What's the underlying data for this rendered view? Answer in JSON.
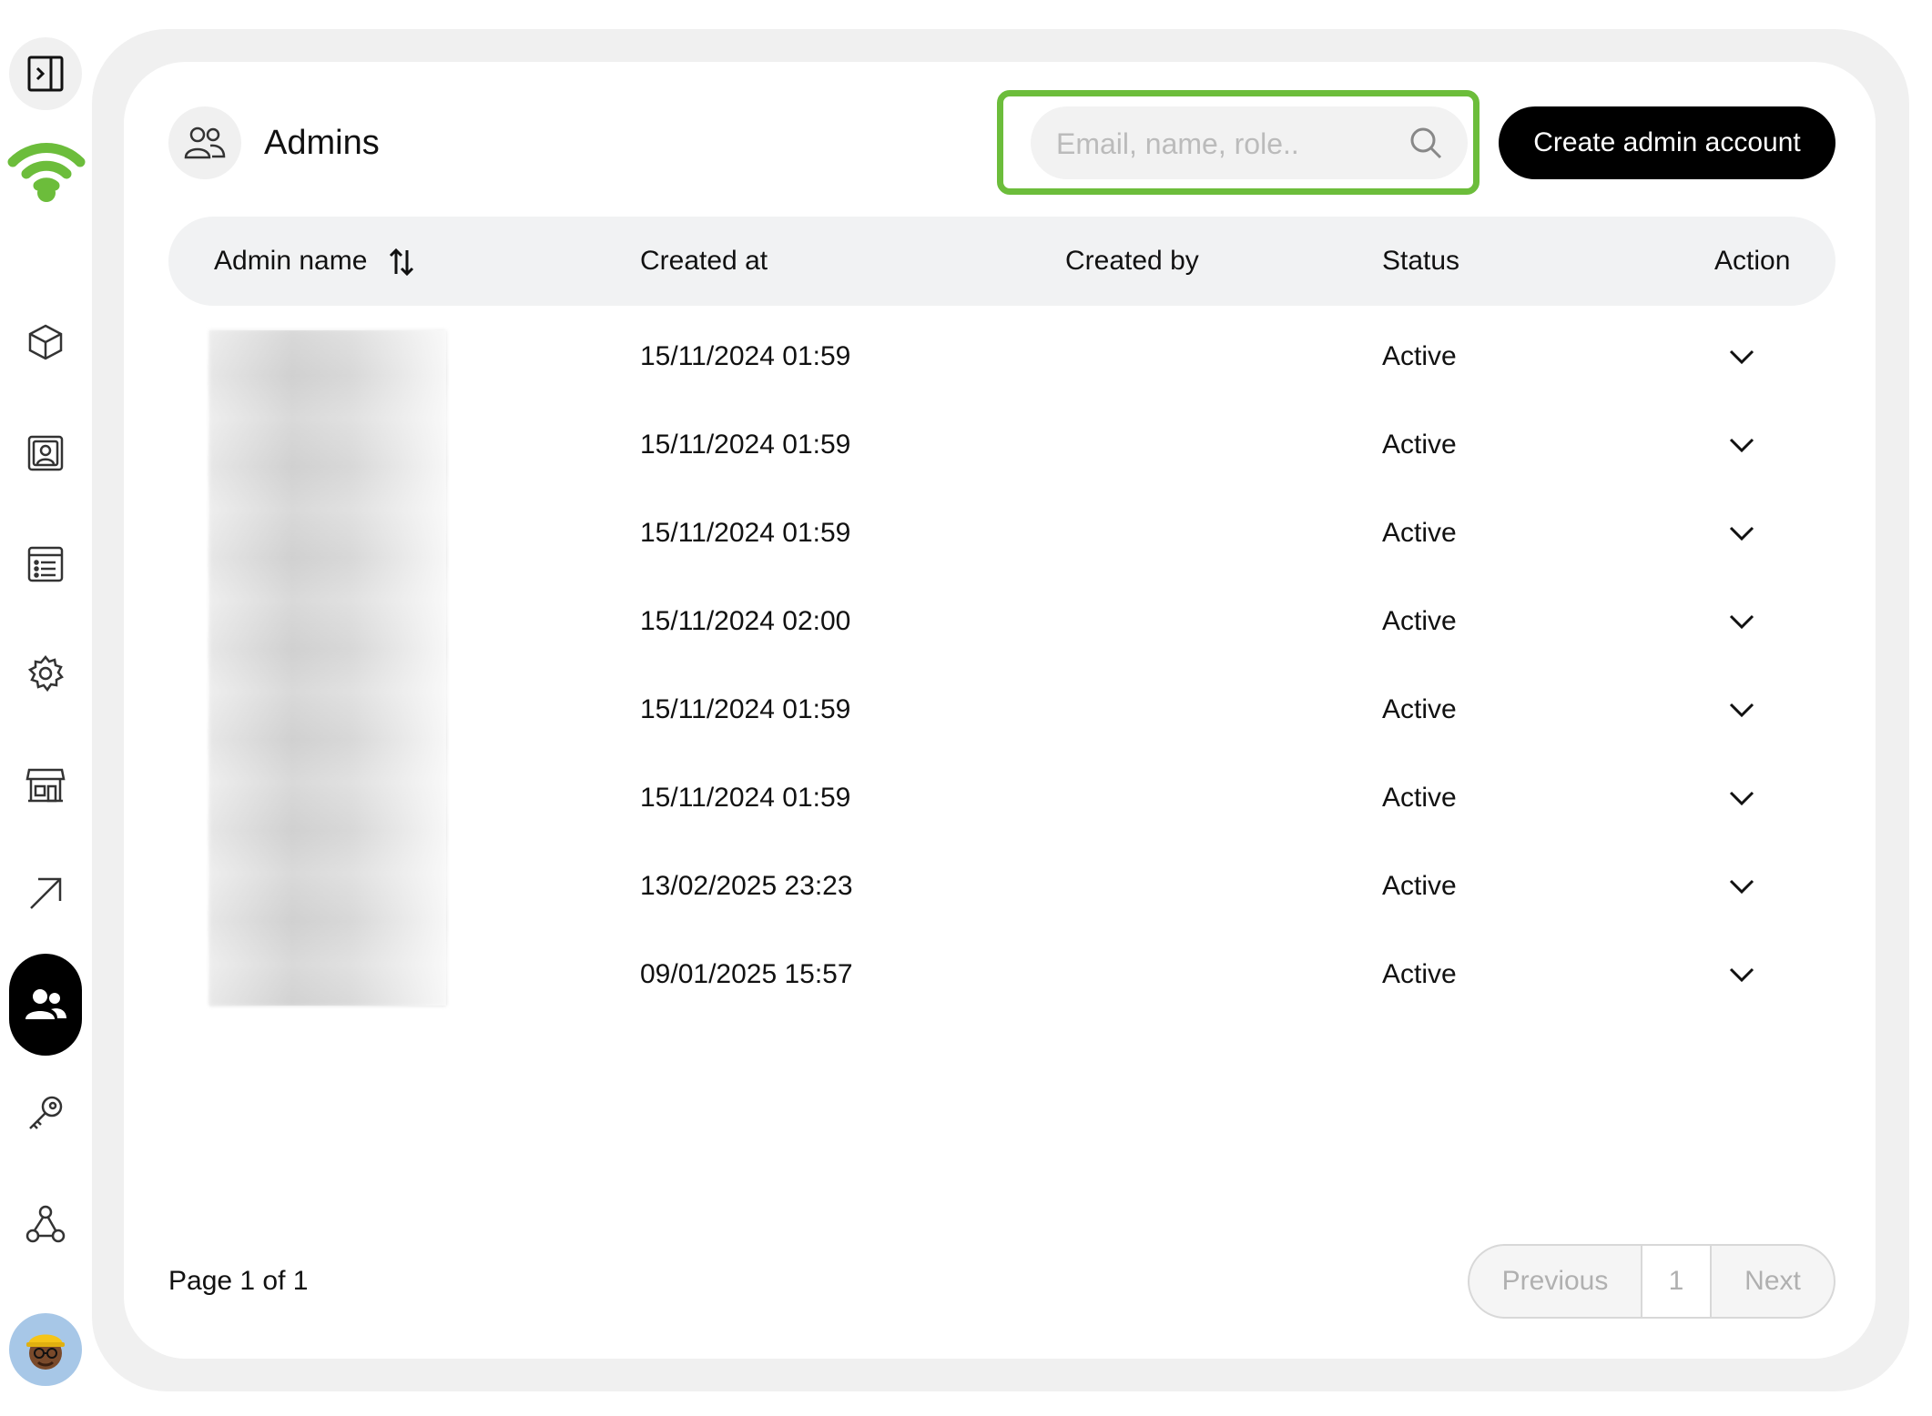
{
  "page": {
    "title": "Admins"
  },
  "sidebar": {
    "items": [
      {
        "name": "products",
        "icon": "box-icon"
      },
      {
        "name": "contacts",
        "icon": "contact-card-icon"
      },
      {
        "name": "lists",
        "icon": "list-icon"
      },
      {
        "name": "settings",
        "icon": "gear-icon"
      },
      {
        "name": "store",
        "icon": "store-icon"
      },
      {
        "name": "outbound",
        "icon": "arrow-up-right-icon"
      },
      {
        "name": "admins",
        "icon": "users-icon",
        "active": true
      },
      {
        "name": "keys",
        "icon": "key-icon"
      },
      {
        "name": "webhooks",
        "icon": "webhook-icon"
      }
    ]
  },
  "search": {
    "placeholder": "Email, name, role.."
  },
  "toolbar": {
    "create_label": "Create admin account"
  },
  "table": {
    "columns": [
      "Admin name",
      "Created at",
      "Created by",
      "Status",
      "Action"
    ],
    "rows": [
      {
        "created_at": "15/11/2024 01:59",
        "created_by": "",
        "status": "Active"
      },
      {
        "created_at": "15/11/2024 01:59",
        "created_by": "",
        "status": "Active"
      },
      {
        "created_at": "15/11/2024 01:59",
        "created_by": "",
        "status": "Active"
      },
      {
        "created_at": "15/11/2024 02:00",
        "created_by": "",
        "status": "Active"
      },
      {
        "created_at": "15/11/2024 01:59",
        "created_by": "",
        "status": "Active"
      },
      {
        "created_at": "15/11/2024 01:59",
        "created_by": "",
        "status": "Active"
      },
      {
        "created_at": "13/02/2025 23:23",
        "created_by": "",
        "status": "Active"
      },
      {
        "created_at": "09/01/2025 15:57",
        "created_by": "",
        "status": "Active"
      }
    ]
  },
  "pagination": {
    "info": "Page 1 of 1",
    "previous": "Previous",
    "current": "1",
    "next": "Next"
  },
  "colors": {
    "accent": "#6cbd3b",
    "primary_button": "#000000",
    "frame": "#f0f0f0"
  }
}
